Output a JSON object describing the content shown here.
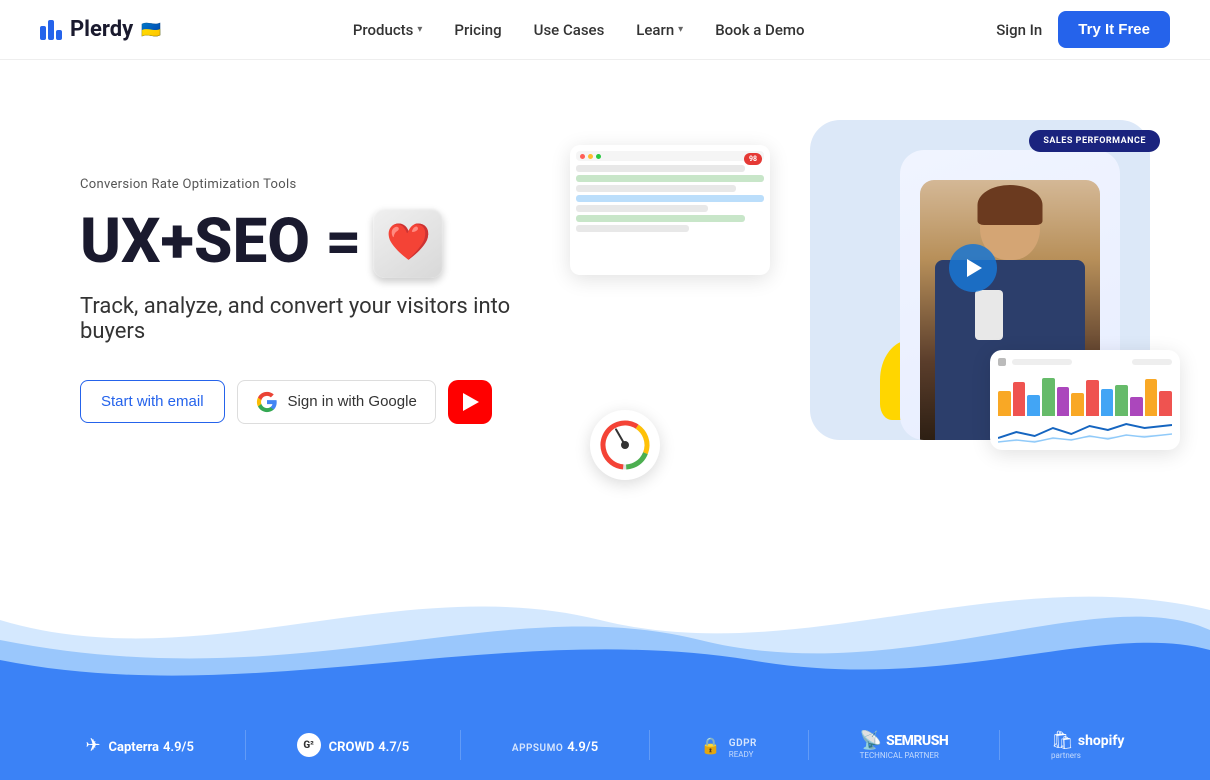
{
  "header": {
    "logo_text": "Plerdy",
    "logo_flag": "🇺🇦",
    "nav": [
      {
        "label": "Products",
        "has_dropdown": true
      },
      {
        "label": "Pricing",
        "has_dropdown": false
      },
      {
        "label": "Use Cases",
        "has_dropdown": false
      },
      {
        "label": "Learn",
        "has_dropdown": true
      },
      {
        "label": "Book a Demo",
        "has_dropdown": false
      }
    ],
    "sign_in_label": "Sign In",
    "try_free_label": "Try It Free"
  },
  "hero": {
    "subtitle": "Conversion Rate Optimization Tools",
    "headline_text": "UX+SEO =",
    "heart_emoji": "❤️",
    "tagline": "Track, analyze, and convert your visitors into buyers",
    "buttons": {
      "start_email": "Start with email",
      "sign_in_google": "Sign in with Google",
      "youtube_aria": "Watch video"
    }
  },
  "hero_ui": {
    "sales_performance_label": "SALES PERFORMANCE",
    "screenshot_score": "98",
    "gauge_aria": "Performance gauge",
    "play_aria": "Play video"
  },
  "partners": [
    {
      "icon": "✈",
      "name": "Capterra",
      "rating": "4.9/5"
    },
    {
      "icon": "G²",
      "name": "CROWD",
      "rating": "4.7/5"
    },
    {
      "icon": "",
      "name": "APPSUMO",
      "rating": "4.9/5"
    },
    {
      "icon": "🔒",
      "name": "GDPR",
      "rating": "READY"
    },
    {
      "name": "SEMRUSH",
      "sublabel": "TECHNICAL PARTNER"
    },
    {
      "name": "shopify",
      "sublabel": "partners"
    }
  ]
}
